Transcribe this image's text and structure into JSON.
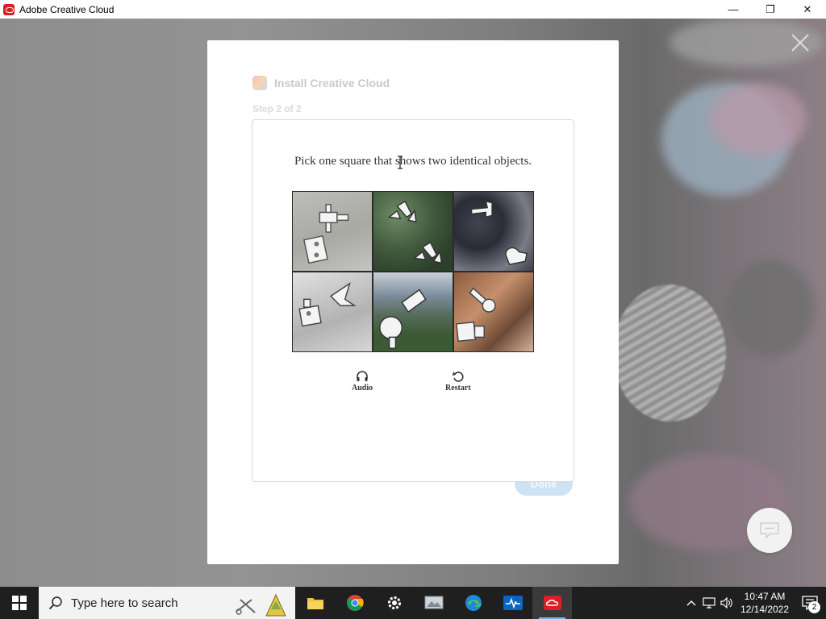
{
  "window": {
    "title": "Adobe Creative Cloud",
    "controls": {
      "minimize": "—",
      "maximize": "❐",
      "close": "✕"
    }
  },
  "installer": {
    "title": "Install Creative Cloud",
    "step": "Step 2 of 2",
    "done_label": "Done"
  },
  "captcha": {
    "instruction": "Pick one square that shows two identical objects.",
    "tiles": [
      "tile-1",
      "tile-2",
      "tile-3",
      "tile-4",
      "tile-5",
      "tile-6"
    ],
    "audio_label": "Audio",
    "restart_label": "Restart"
  },
  "taskbar": {
    "search_placeholder": "Type here to search",
    "pinned": [
      "file-explorer-icon",
      "chrome-icon",
      "settings-icon",
      "photos-icon",
      "edge-icon",
      "health-icon",
      "creative-cloud-icon"
    ],
    "time": "10:47 AM",
    "date": "12/14/2022",
    "notification_count": "2"
  },
  "colors": {
    "accent": "#da1f26",
    "done_button": "#cfe2f5",
    "taskbar": "#1f1f1f"
  }
}
